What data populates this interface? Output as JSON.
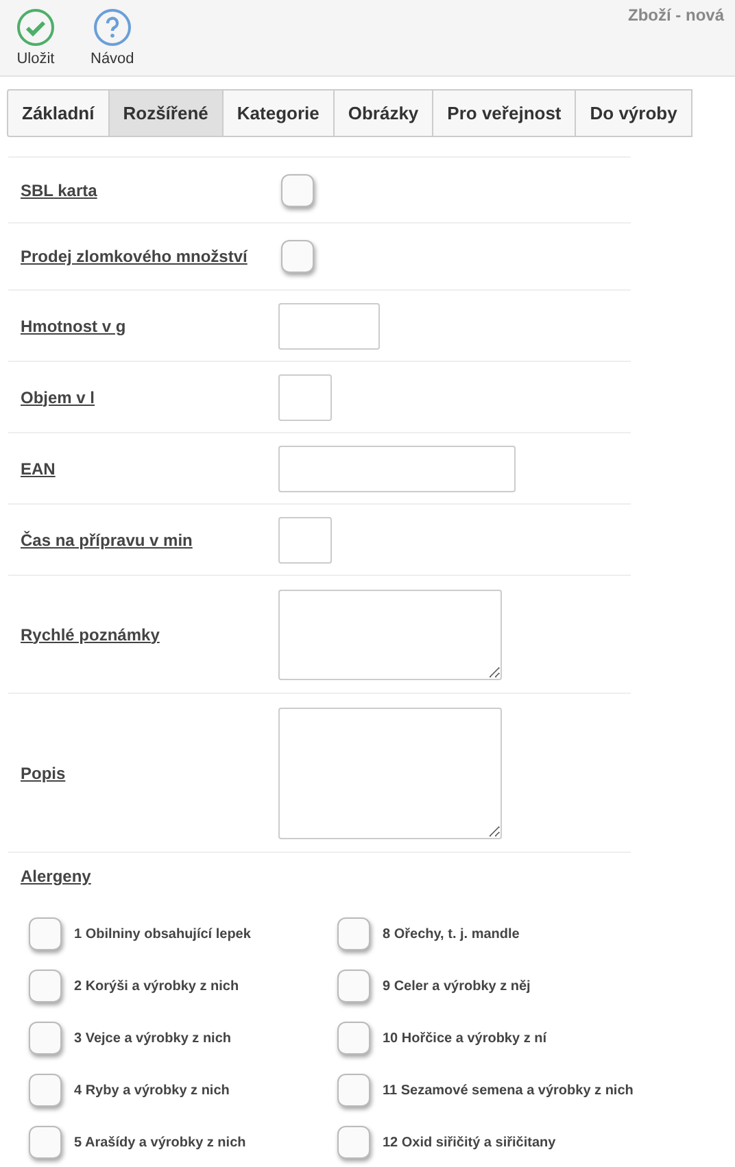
{
  "toolbar": {
    "buttons": [
      {
        "label": "Uložit",
        "kind": "save"
      },
      {
        "label": "Návod",
        "kind": "help"
      }
    ],
    "title": "Zboží - nová"
  },
  "tabs": [
    {
      "label": "Základní",
      "selected": false
    },
    {
      "label": "Rozšířené",
      "selected": true
    },
    {
      "label": "Kategorie",
      "selected": false
    },
    {
      "label": "Obrázky",
      "selected": false
    },
    {
      "label": "Pro veřejnost",
      "selected": false
    },
    {
      "label": "Do výroby",
      "selected": false
    }
  ],
  "fields": [
    {
      "label": "SBL karta",
      "kind": "checkbox",
      "checked": false
    },
    {
      "label": "Prodej zlomkového množství",
      "kind": "checkbox",
      "checked": false
    },
    {
      "label": "Hmotnost v g",
      "kind": "input"
    },
    {
      "label": "Objem v l",
      "kind": "input"
    },
    {
      "label": "EAN",
      "kind": "input"
    },
    {
      "label": "Čas na přípravu v min",
      "kind": "input"
    },
    {
      "label": "Rychlé poznámky",
      "kind": "textarea"
    },
    {
      "label": "Popis",
      "kind": "textarea"
    }
  ],
  "allergens": {
    "title": "Alergeny",
    "items": [
      {
        "label": "1 Obilniny obsahující lepek",
        "checked": false
      },
      {
        "label": "2 Korýši a výrobky z nich",
        "checked": false
      },
      {
        "label": "3 Vejce a výrobky z nich",
        "checked": false
      },
      {
        "label": "4 Ryby a výrobky z nich",
        "checked": false
      },
      {
        "label": "5 Arašídy a výrobky z nich",
        "checked": false
      },
      {
        "label": "8 Ořechy, t. j. mandle",
        "checked": false
      },
      {
        "label": "9 Celer a výrobky z něj",
        "checked": false
      },
      {
        "label": "10 Hořčice a výrobky z ní",
        "checked": false
      },
      {
        "label": "11 Sezamové semena a výrobky z nich",
        "checked": false
      },
      {
        "label": "12 Oxid siřičitý a siřičitany",
        "checked": false
      }
    ]
  }
}
